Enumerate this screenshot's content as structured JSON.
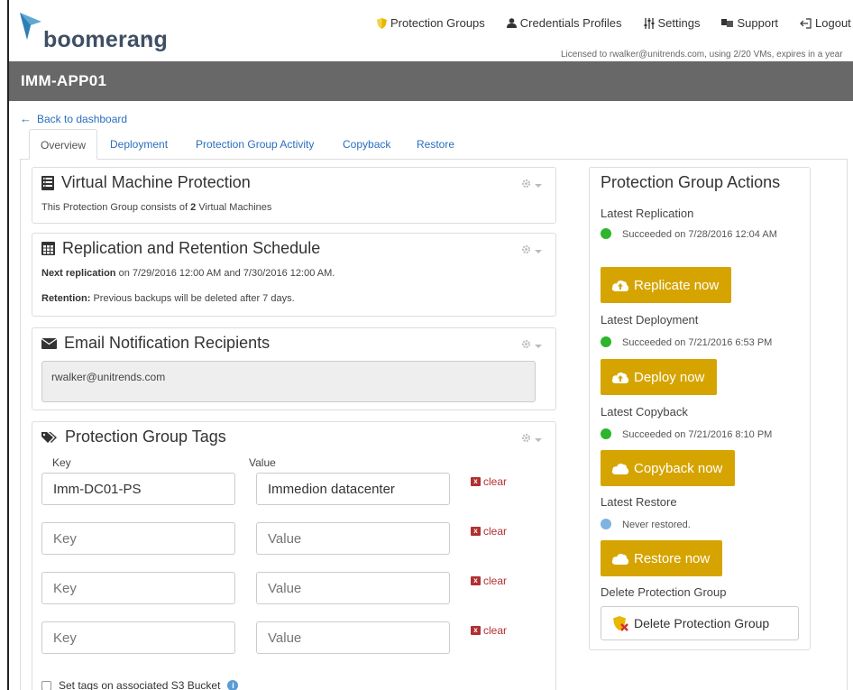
{
  "brand": {
    "name": "boomerang",
    "tm": "™"
  },
  "nav": [
    {
      "label": "Protection Groups",
      "icon": "shield-icon"
    },
    {
      "label": "Credentials Profiles",
      "icon": "user-icon"
    },
    {
      "label": "Settings",
      "icon": "sliders-icon"
    },
    {
      "label": "Support",
      "icon": "flag-icon"
    },
    {
      "label": "Logout",
      "icon": "logout-icon"
    }
  ],
  "license": "Licensed to rwalker@unitrends.com, using 2/20 VMs, expires in a year",
  "page_title": "IMM-APP01",
  "back_link": "Back to dashboard",
  "tabs": [
    "Overview",
    "Deployment",
    "Protection Group Activity",
    "Copyback",
    "Restore"
  ],
  "panels": {
    "vm": {
      "title": "Virtual Machine Protection",
      "text_prefix": "This Protection Group consists of ",
      "count": "2",
      "text_suffix": " Virtual Machines"
    },
    "schedule": {
      "title": "Replication and Retention Schedule",
      "next_label": "Next replication",
      "next_text": " on 7/29/2016 12:00 AM and 7/30/2016 12:00 AM.",
      "retention_label": "Retention:",
      "retention_text": " Previous backups will be deleted after 7 days."
    },
    "email": {
      "title": "Email Notification Recipients",
      "value": "rwalker@unitrends.com"
    },
    "tags": {
      "title": "Protection Group Tags",
      "key_header": "Key",
      "value_header": "Value",
      "key_placeholder": "Key",
      "value_placeholder": "Value",
      "clear_label": "clear",
      "rows": [
        {
          "key": "Imm-DC01-PS",
          "value": "Immedion datacenter"
        },
        {
          "key": "",
          "value": ""
        },
        {
          "key": "",
          "value": ""
        },
        {
          "key": "",
          "value": ""
        }
      ],
      "s3_label": "Set tags on associated S3 Bucket"
    }
  },
  "actions": {
    "title": "Protection Group Actions",
    "replication": {
      "heading": "Latest Replication",
      "status": "Succeeded on 7/28/2016 12:04 AM",
      "button": "Replicate now"
    },
    "deployment": {
      "heading": "Latest Deployment",
      "status": "Succeeded on 7/21/2016 6:53 PM",
      "button": "Deploy now"
    },
    "copyback": {
      "heading": "Latest Copyback",
      "status": "Succeeded on 7/21/2016 8:10 PM",
      "button": "Copyback now"
    },
    "restore": {
      "heading": "Latest Restore",
      "status": "Never restored.",
      "button": "Restore now"
    },
    "delete": {
      "heading": "Delete Protection Group",
      "button": "Delete Protection Group"
    }
  },
  "colors": {
    "accent_button": "#d6a400",
    "status_success": "#2db52d",
    "status_never": "#7fb3e0",
    "link": "#2a6ebf",
    "title_bar": "#686868",
    "clear_red": "#b03030"
  }
}
